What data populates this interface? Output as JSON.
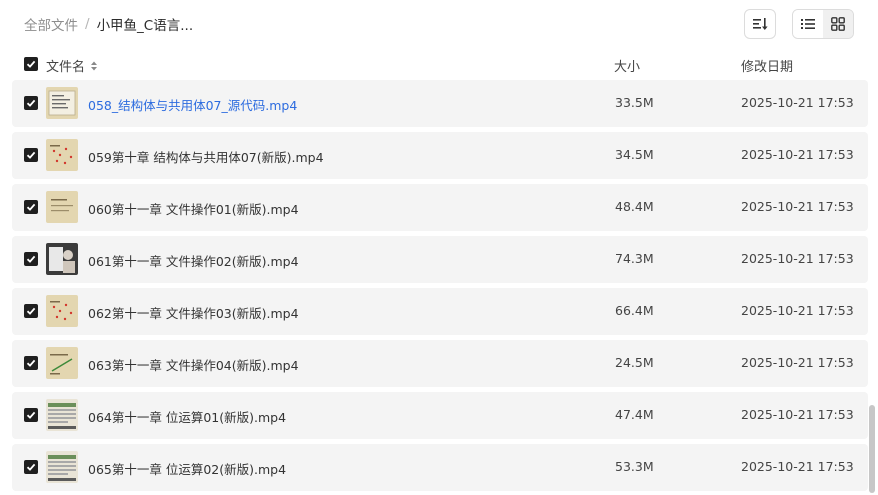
{
  "breadcrumb": {
    "root": "全部文件",
    "separator": "/",
    "current": "小甲鱼_C语言..."
  },
  "toolbar": {
    "sort_icon": "sort-icon",
    "list_view_icon": "list-view-icon",
    "grid_view_icon": "grid-view-icon"
  },
  "header": {
    "name": "文件名",
    "size": "大小",
    "modified": "修改日期"
  },
  "colors": {
    "accent_link": "#2d6cdf",
    "row_bg": "#f4f4f4",
    "checkbox": "#1f1f1f"
  },
  "files": [
    {
      "name": "058_结构体与共用体07_源代码.mp4",
      "size": "33.5M",
      "date": "2025-10-21 17:53",
      "thumb": "beige-doc"
    },
    {
      "name": "059第十章 结构体与共用体07(新版).mp4",
      "size": "34.5M",
      "date": "2025-10-21 17:53",
      "thumb": "beige-red"
    },
    {
      "name": "060第十一章 文件操作01(新版).mp4",
      "size": "48.4M",
      "date": "2025-10-21 17:53",
      "thumb": "beige-plain"
    },
    {
      "name": "061第十一章 文件操作02(新版).mp4",
      "size": "74.3M",
      "date": "2025-10-21 17:53",
      "thumb": "dark-photo"
    },
    {
      "name": "062第十一章 文件操作03(新版).mp4",
      "size": "66.4M",
      "date": "2025-10-21 17:53",
      "thumb": "beige-red"
    },
    {
      "name": "063第十一章 文件操作04(新版).mp4",
      "size": "24.5M",
      "date": "2025-10-21 17:53",
      "thumb": "beige-green"
    },
    {
      "name": "064第十一章 位运算01(新版).mp4",
      "size": "47.4M",
      "date": "2025-10-21 17:53",
      "thumb": "screen-table"
    },
    {
      "name": "065第十一章 位运算02(新版).mp4",
      "size": "53.3M",
      "date": "2025-10-21 17:53",
      "thumb": "screen-table"
    }
  ]
}
